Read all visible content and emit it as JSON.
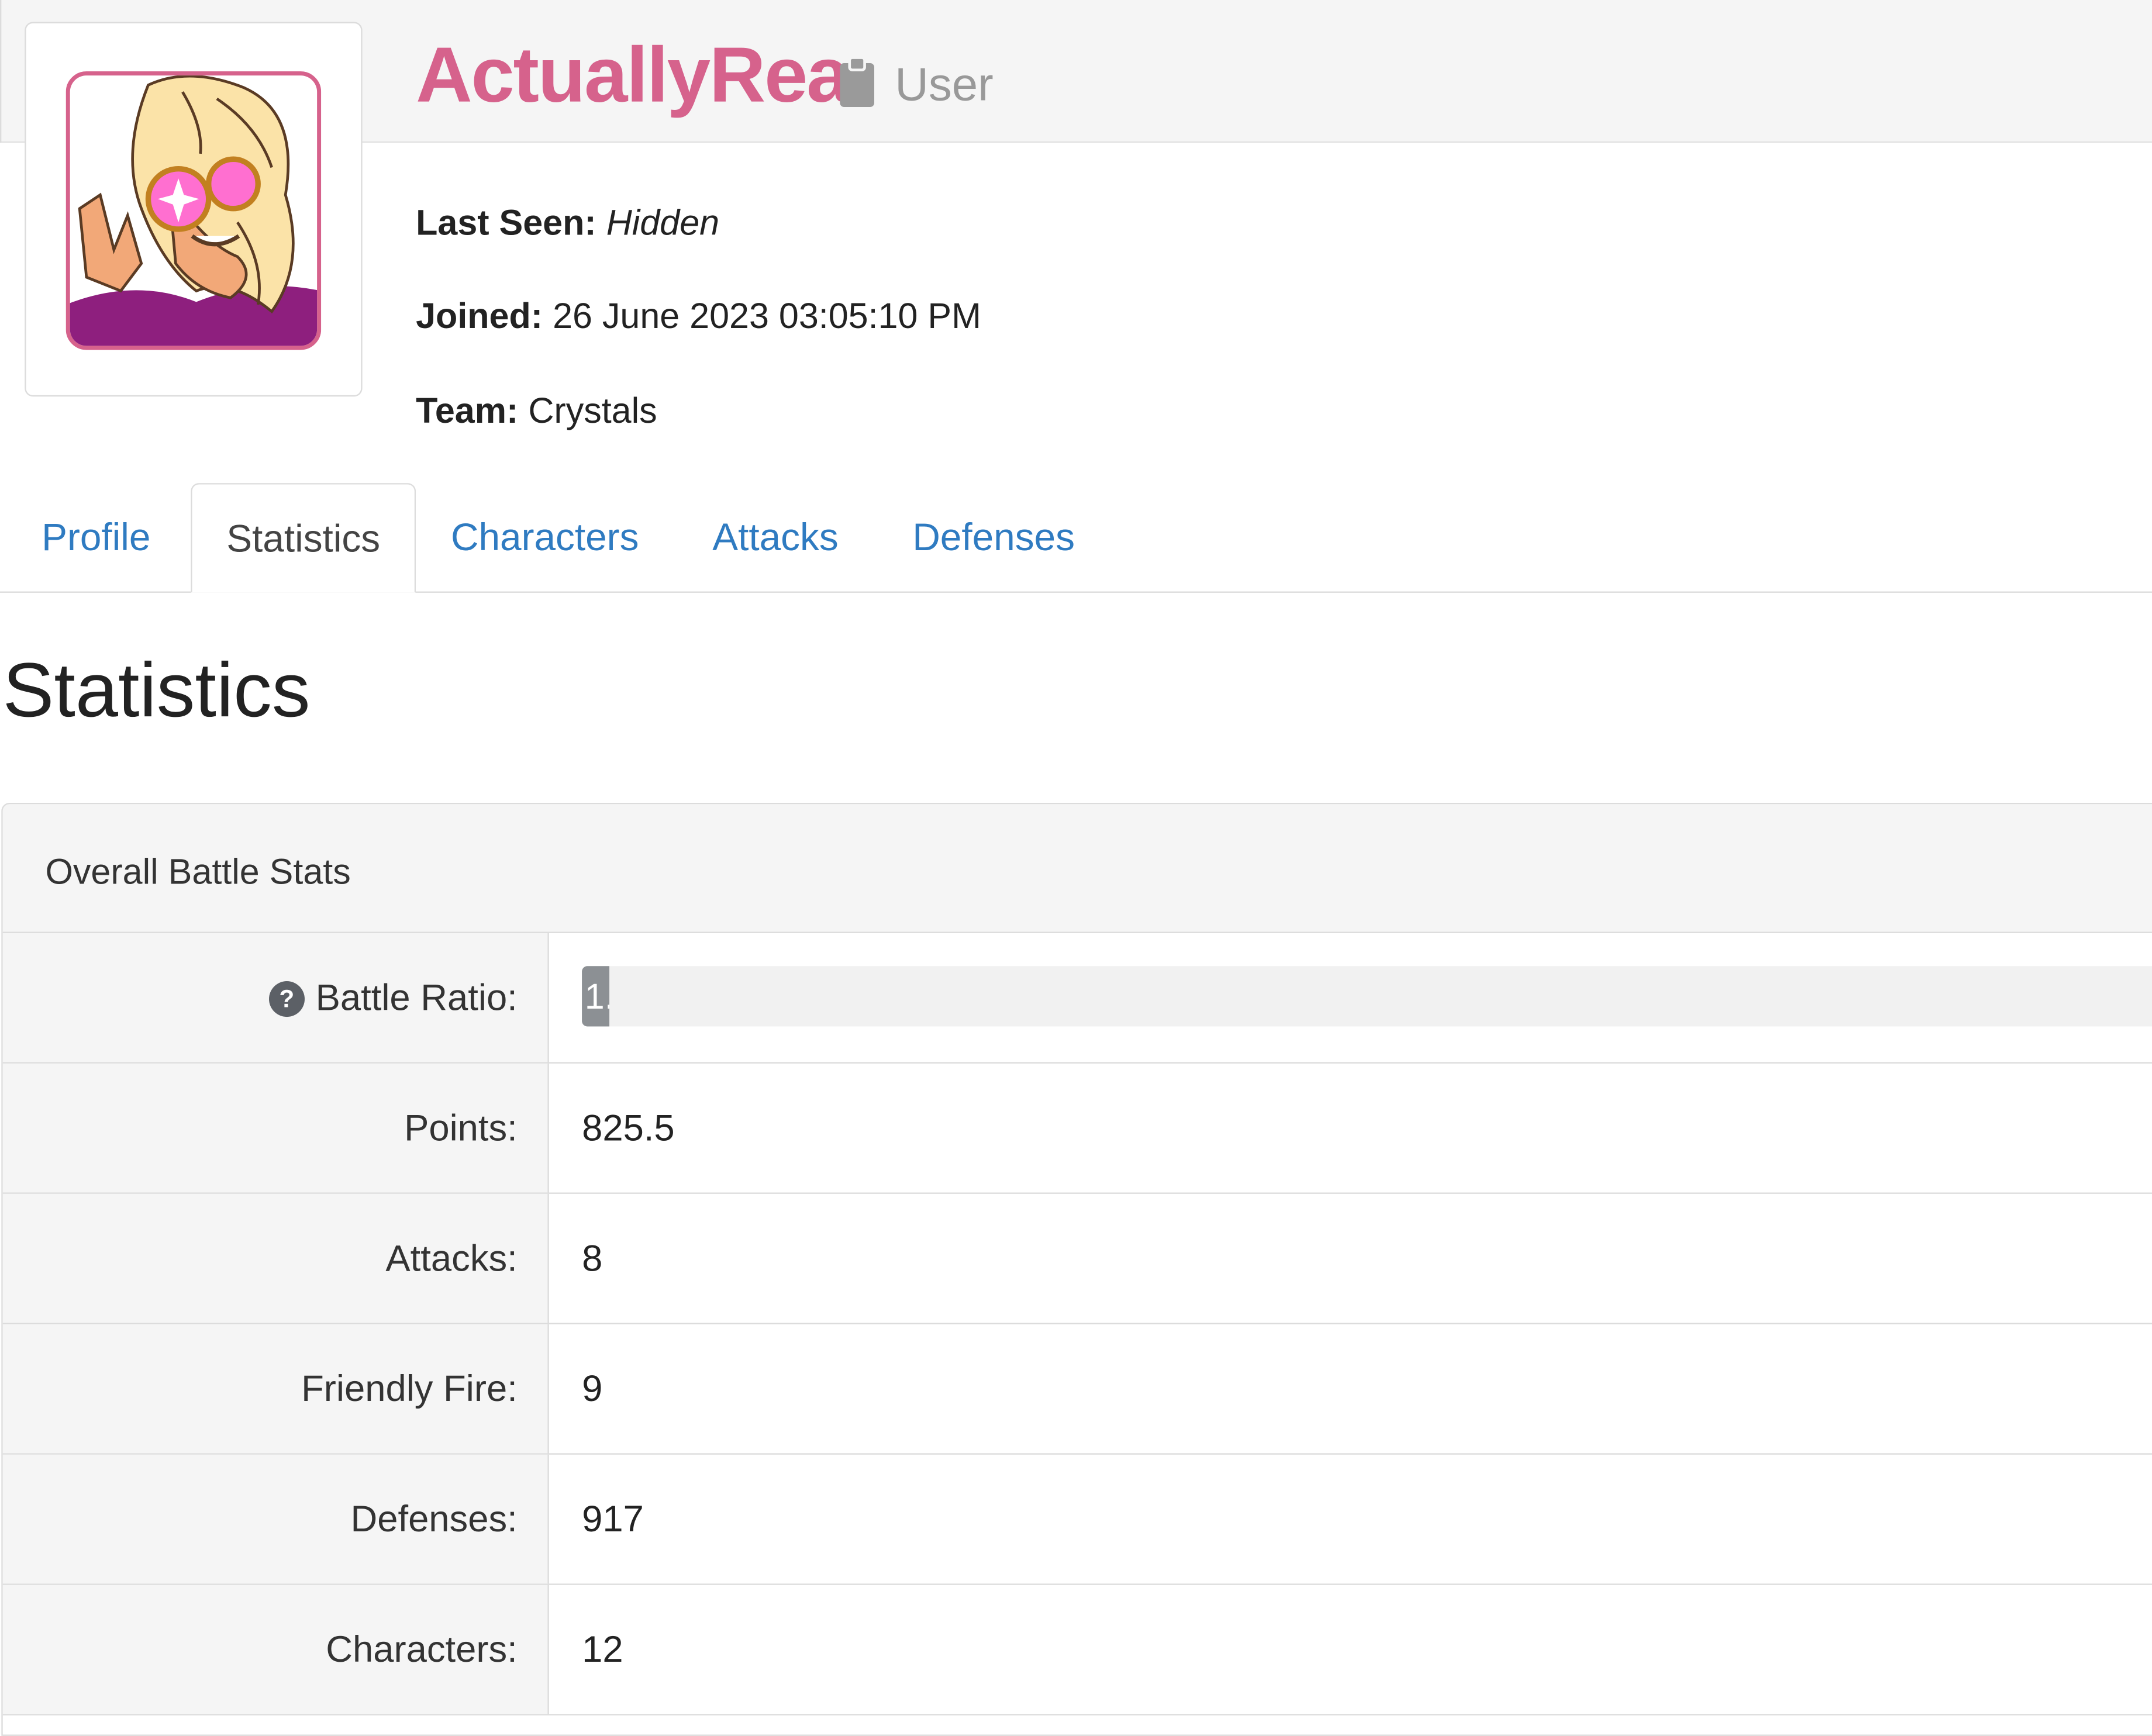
{
  "profile": {
    "username": "ActuallyRea",
    "role": "User",
    "role_icon": "clipboard-icon",
    "username_color": "#d6628c",
    "last_seen_label": "Last Seen:",
    "last_seen_value": "Hidden",
    "joined_label": "Joined:",
    "joined_value": "26 June 2023 03:05:10 PM",
    "team_label": "Team:",
    "team_value": "Crystals"
  },
  "tabs": [
    {
      "label": "Profile",
      "active": false
    },
    {
      "label": "Statistics",
      "active": true
    },
    {
      "label": "Characters",
      "active": false
    },
    {
      "label": "Attacks",
      "active": false
    },
    {
      "label": "Defenses",
      "active": false
    }
  ],
  "page_title": "Statistics",
  "stats_panel": {
    "title": "Overall Battle Stats",
    "battle_ratio": {
      "label": "Battle Ratio:",
      "help_icon": "question-circle-icon",
      "bar_text": "1.",
      "fill_fraction": 0.017
    },
    "rows": [
      {
        "label": "Points:",
        "value": "825.5"
      },
      {
        "label": "Attacks:",
        "value": "8"
      },
      {
        "label": "Friendly Fire:",
        "value": "9"
      },
      {
        "label": "Defenses:",
        "value": "917"
      },
      {
        "label": "Characters:",
        "value": "12"
      }
    ]
  },
  "colors": {
    "link": "#2f7bc1",
    "panel_bg": "#f5f5f5",
    "border": "#dcdcdc",
    "progress_fill": "#8c9094"
  }
}
